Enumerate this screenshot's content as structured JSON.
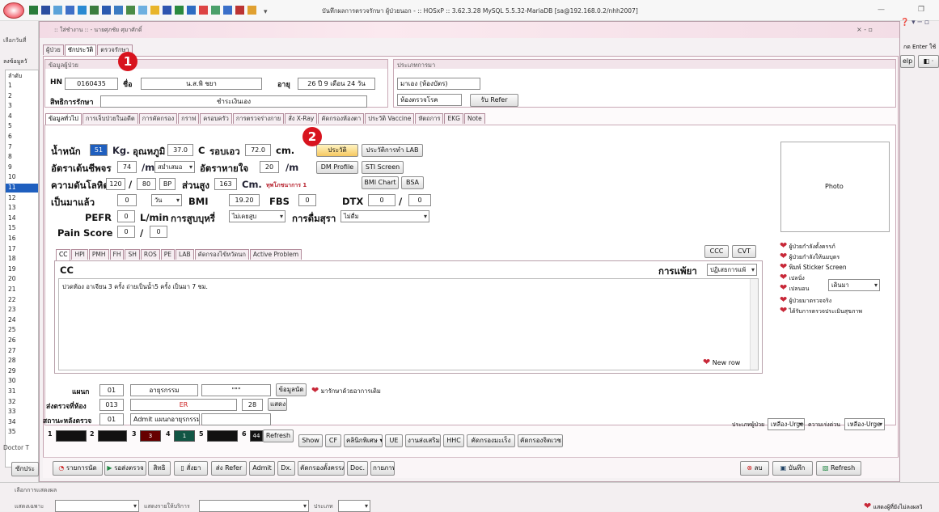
{
  "window": {
    "title": "บันทึกผลการตรวจรักษา ผู้ป่วยนอก - :: HOSxP :: 3.62.3.28 MySQL 5.5.32-MariaDB [sa@192.168.0.2/nhh2007]",
    "ctrl_sym": "—",
    "restore_sym": "❐"
  },
  "left_panel": {
    "menu_label": "เลือกวันที่",
    "data_label": "ลงข้อมูลวั",
    "col_header": "ลำดับ",
    "rows": [
      "1",
      "2",
      "3",
      "4",
      "5",
      "6",
      "7",
      "8",
      "9",
      "10",
      "11",
      "12",
      "13",
      "14",
      "15",
      "16",
      "17",
      "18",
      "19",
      "20",
      "21",
      "22",
      "23",
      "24",
      "25",
      "26",
      "27",
      "28",
      "29",
      "30",
      "31",
      "32",
      "33",
      "34",
      "35"
    ],
    "selected": "11",
    "doctor_label": "Doctor T",
    "bottom_btn": "ซักประ"
  },
  "right_panel": {
    "hint": "กด Enter ใช้",
    "help": "elp",
    "symbols": "❓ ▾ ─ ▫"
  },
  "inner_window": {
    "title": ":: ใส่ชำงาน :: - นายศุภชัย ศุมาศักดิ์",
    "close": "× - ▫"
  },
  "top_tabs": [
    "ผู้ป่วย",
    "ซักประวัติ",
    "ตรวจรักษา"
  ],
  "patient": {
    "section_label": "ข้อมูลผู้ป่วย",
    "hn_label": "HN",
    "hn": "0160435",
    "name_label": "ชื่อ",
    "name": "น.ส.พิ ชยา",
    "age_label": "อายุ",
    "age": "26 ปี 9 เดือน 24 วัน",
    "rights_label": "สิทธิการรักษา",
    "rights": "ชำระเงินเอง"
  },
  "visit": {
    "section_label": "ประเภทการมา",
    "type": "มาเอง (ห้องบัตร)",
    "room": "ห้องตรวจโรค",
    "refer_btn": "รับ Refer"
  },
  "main_tabs": [
    "ข้อมูลทั่วไป",
    "การเจ็บป่วยในอดีต",
    "การคัดกรอง",
    "กราฟ",
    "ครอบครัว",
    "การตรวจร่างกาย",
    "สั่ง X-Ray",
    "คัดกรองห้องตา",
    "ประวัติ Vaccine",
    "หัตถการ",
    "EKG",
    "Note"
  ],
  "vitals": {
    "weight_label": "น้ำหนัก",
    "weight": "51",
    "kg": "Kg.",
    "temp_label": "อุณหภูมิ",
    "temp": "37.0",
    "c": "C",
    "waist_label": "รอบเอว",
    "waist": "72.0",
    "cm": "cm.",
    "pulse_label": "อัตราเต้นชีพจร",
    "pulse": "74",
    "per_m": "/m",
    "pulse_type": "สม่ำเสมอ",
    "resp_label": "อัตราหายใจ",
    "resp": "20",
    "bp_label": "ความดันโลหิต",
    "sbp": "120",
    "slash": "/",
    "dbp": "80",
    "bp": "BP",
    "height_label": "ส่วนสูง",
    "height": "163",
    "cm2": "Cm.",
    "risk": "ทุพโภชนาการ 1",
    "since_label": "เป็นมาแล้ว",
    "since": "0",
    "since_unit": "วัน",
    "bmi_label": "BMI",
    "bmi": "19.20",
    "fbs_label": "FBS",
    "fbs": "0",
    "dtx_label": "DTX",
    "dtx1": "0",
    "dtx2": "0",
    "pefr_label": "PEFR",
    "pefr": "0",
    "lmin": "L/min",
    "smoke_label": "การสูบบุหรี่",
    "smoke": "ไม่เคยสูบ",
    "drink_label": "การดื่มสุรา",
    "drink": "ไม่ดื่ม",
    "pain_label": "Pain Score",
    "pain1": "0",
    "pain2": "0"
  },
  "vital_buttons": {
    "history": "ประวัติ",
    "lab_history": "ประวัติการทำ LAB",
    "dm": "DM Profile",
    "sti": "STI Screen",
    "bmi_chart": "BMI Chart",
    "bsa": "BSA"
  },
  "photo_label": "Photo",
  "cc_tabs": [
    "CC",
    "HPI",
    "PMH",
    "FH",
    "SH",
    "ROS",
    "PE",
    "LAB",
    "คัดกรองไข้หวัดนก",
    "Active Problem"
  ],
  "cc": {
    "label": "CC",
    "allergy_label": "การแพ้ยา",
    "allergy": "ปฏิเสธการแพ้",
    "text": "ปวดท้อง อาเจียน 3 ครั้ง ถ่ายเป็นน้ำ5 ครั้ง เป็นมา 7 ชม.",
    "ccc": "CCC",
    "cvt": "CVT",
    "new_row": "New row"
  },
  "status_opts": [
    "ผู้ป่วยกำลังตั้งครรภ์",
    "ผู้ป่วยกำลังให้นมบุตร",
    "พิมพ์ Sticker Screen",
    "เปลนั่ง",
    "เปลนอน",
    "ผู้ป่วยมาตรวจจริง",
    "ได้รับการตรวจประเมินสุขภาพ"
  ],
  "walk_combo": "เดินมา",
  "dept": {
    "label": "แผนก",
    "code": "01",
    "name": "อายุรกรรม",
    "extra": "\"\"\"",
    "info_btn": "ข้อมูลนัด",
    "note": "มารักษาด้วยอาการเดิม"
  },
  "send_room": {
    "label": "ส่งตรวจที่ห้อง",
    "code": "013",
    "name": "ER",
    "num": "28",
    "show_btn": "แสดง"
  },
  "post_status": {
    "label": "สถานะหลังตรวจ",
    "code": "01",
    "name": "Admit แผนกอายุรกรรม"
  },
  "patient_type": {
    "label": "ประเภทผู้ป่วย",
    "value": "เหลือง-Urge",
    "urgency_label": "ความเร่งด่วน",
    "urgency": "เหลือง-Urge"
  },
  "counters": [
    {
      "n": "1",
      "v": ""
    },
    {
      "n": "2",
      "v": ""
    },
    {
      "n": "3",
      "v": "3"
    },
    {
      "n": "4",
      "v": "1"
    },
    {
      "n": "5",
      "v": ""
    },
    {
      "n": "6",
      "v": "44"
    }
  ],
  "refresh": "Refresh",
  "quick_btns": [
    "Show",
    "CF",
    "คลินิกพิเศษ ▾",
    "UE",
    "งานส่งเสริม",
    "HHC",
    "คัดกรองมะเร็ง",
    "คัดกรองจิตเวช"
  ],
  "action_btns": [
    "รายการนัด",
    "รอส่งตรวจ",
    "สิทธิ",
    "สั่งยา",
    "ส่ง Refer",
    "Admit",
    "Dx.",
    "คัดกรองตั้งครรภ์",
    "Doc.",
    "กายภาพ"
  ],
  "delete_btn": "ลบ",
  "save_btn": "บันทึก",
  "refresh_btn": "Refresh",
  "footer": {
    "select_label": "เลือกการแสดงผล",
    "show_label": "แสดงเฉพาะ",
    "service_label": "แสดงรายให้บริการ",
    "status_label": "ประเภท",
    "right_note": "แสดงผู้ที่ยังไม่ลงผลวิ"
  },
  "markers": [
    "1",
    "2"
  ]
}
